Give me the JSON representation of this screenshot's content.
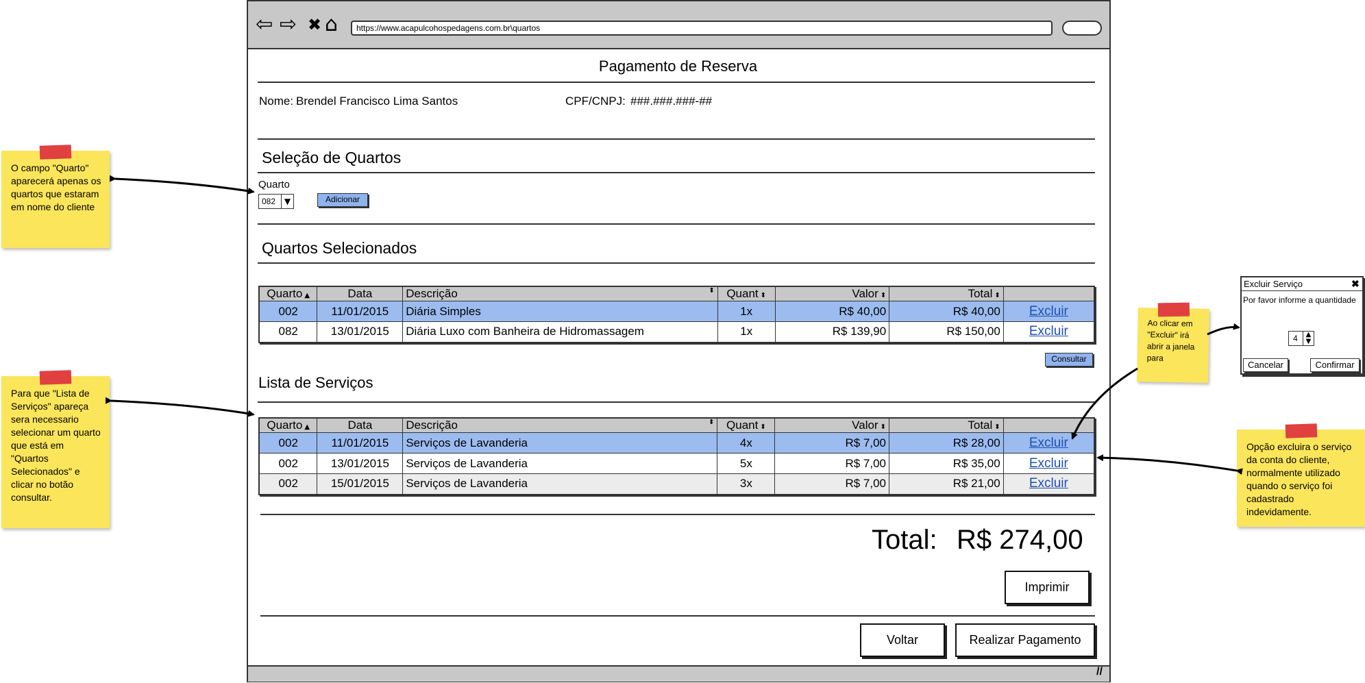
{
  "browser": {
    "url": "https://www.acapulcohospedagens.com.br\\quartos",
    "back_icon": "⇦",
    "forward_icon": "⇨",
    "close_icon": "✖",
    "home_icon": "⌂"
  },
  "page": {
    "title": "Pagamento de Reserva",
    "nome_label": "Nome:",
    "nome_value": "Brendel Francisco Lima Santos",
    "cpf_label": "CPF/CNPJ:",
    "cpf_value": "###.###.###-##"
  },
  "selecao": {
    "heading": "Seleção de Quartos",
    "quarto_label": "Quarto",
    "quarto_value": "082",
    "adicionar_label": "Adicionar"
  },
  "quartos": {
    "heading": "Quartos Selecionados",
    "columns": [
      "Quarto",
      "Data",
      "Descrição",
      "Quant",
      "Valor",
      "Total",
      ""
    ],
    "rows": [
      {
        "quarto": "002",
        "data": "11/01/2015",
        "descricao": "Diária Simples",
        "quant": "1x",
        "valor": "R$ 40,00",
        "total": "R$ 40,00",
        "acao": "Excluir"
      },
      {
        "quarto": "082",
        "data": "13/01/2015",
        "descricao": "Diária Luxo com Banheira de Hidromassagem",
        "quant": "1x",
        "valor": "R$ 139,90",
        "total": "R$ 150,00",
        "acao": "Excluir"
      }
    ],
    "consultar_label": "Consultar"
  },
  "servicos": {
    "heading": "Lista de Serviços",
    "columns": [
      "Quarto",
      "Data",
      "Descrição",
      "Quant",
      "Valor",
      "Total",
      ""
    ],
    "rows": [
      {
        "quarto": "002",
        "data": "11/01/2015",
        "descricao": "Serviços de Lavanderia",
        "quant": "4x",
        "valor": "R$ 7,00",
        "total": "R$ 28,00",
        "acao": "Excluir"
      },
      {
        "quarto": "002",
        "data": "13/01/2015",
        "descricao": "Serviços de Lavanderia",
        "quant": "5x",
        "valor": "R$ 7,00",
        "total": "R$ 35,00",
        "acao": "Excluir"
      },
      {
        "quarto": "002",
        "data": "15/01/2015",
        "descricao": "Serviços de Lavanderia",
        "quant": "3x",
        "valor": "R$ 7,00",
        "total": "R$ 21,00",
        "acao": "Excluir"
      }
    ]
  },
  "total": {
    "label": "Total:",
    "value": "R$ 274,00"
  },
  "buttons": {
    "imprimir": "Imprimir",
    "voltar": "Voltar",
    "realizar_pagamento": "Realizar Pagamento"
  },
  "notes": {
    "quarto": "O campo \"Quarto\" aparecerá apenas os quartos que estaram em nome do cliente",
    "lista": "Para que \"Lista de Serviços\"  apareça sera necessario selecionar um quarto que está em \"Quartos Selecionados\" e clicar no botão consultar.",
    "excluir_click": "Ao clicar em \"Excluir\" irá abrir a janela para",
    "opcao": "Opção excluira o serviço da conta do cliente, normalmente utilizado quando o serviço foi cadastrado indevidamente."
  },
  "dialog": {
    "title": "Excluir Serviço",
    "message": "Por favor informe a quantidade",
    "quantity": "4",
    "cancel": "Cancelar",
    "confirm": "Confirmar"
  },
  "colors": {
    "selected_row": "#9cbcf0",
    "button_blue": "#8fb3ec",
    "sticky_note": "#fbe55a",
    "tape": "#e04040",
    "link": "#1e4fb2"
  }
}
